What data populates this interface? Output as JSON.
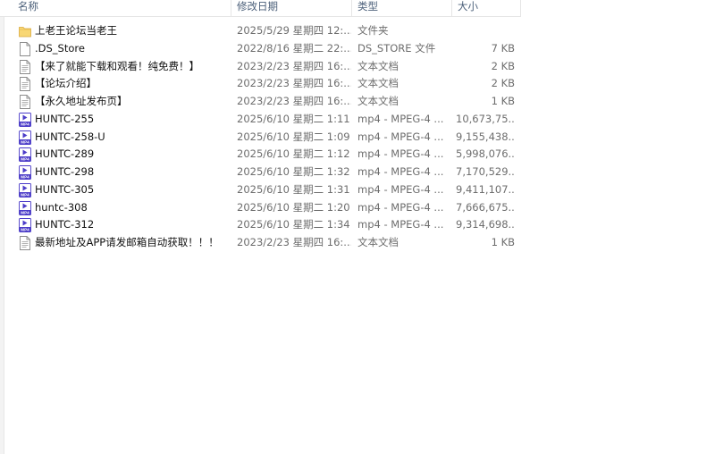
{
  "columns": {
    "name": "名称",
    "date": "修改日期",
    "type": "类型",
    "size": "大小"
  },
  "files": [
    {
      "icon": "folder-icon",
      "name": "上老王论坛当老王",
      "date": "2025/5/29 星期四 12:...",
      "type": "文件夹",
      "size": ""
    },
    {
      "icon": "file-icon",
      "name": ".DS_Store",
      "date": "2022/8/16 星期二 22:...",
      "type": "DS_STORE 文件",
      "size": "7 KB"
    },
    {
      "icon": "text-file-icon",
      "name": "【来了就能下载和观看！纯免费！】",
      "date": "2023/2/23 星期四 16:...",
      "type": "文本文档",
      "size": "2 KB"
    },
    {
      "icon": "text-file-icon",
      "name": "【论坛介绍】",
      "date": "2023/2/23 星期四 16:...",
      "type": "文本文档",
      "size": "2 KB"
    },
    {
      "icon": "text-file-icon",
      "name": "【永久地址发布页】",
      "date": "2023/2/23 星期四 16:...",
      "type": "文本文档",
      "size": "1 KB"
    },
    {
      "icon": "mp4-icon",
      "name": "HUNTC-255",
      "date": "2025/6/10 星期二 1:11",
      "type": "mp4 - MPEG-4 ...",
      "size": "10,673,75..."
    },
    {
      "icon": "mp4-icon",
      "name": "HUNTC-258-U",
      "date": "2025/6/10 星期二 1:09",
      "type": "mp4 - MPEG-4 ...",
      "size": "9,155,438..."
    },
    {
      "icon": "mp4-icon",
      "name": "HUNTC-289",
      "date": "2025/6/10 星期二 1:12",
      "type": "mp4 - MPEG-4 ...",
      "size": "5,998,076..."
    },
    {
      "icon": "mp4-icon",
      "name": "HUNTC-298",
      "date": "2025/6/10 星期二 1:32",
      "type": "mp4 - MPEG-4 ...",
      "size": "7,170,529..."
    },
    {
      "icon": "mp4-icon",
      "name": "HUNTC-305",
      "date": "2025/6/10 星期二 1:31",
      "type": "mp4 - MPEG-4 ...",
      "size": "9,411,107..."
    },
    {
      "icon": "mp4-icon",
      "name": "huntc-308",
      "date": "2025/6/10 星期二 1:20",
      "type": "mp4 - MPEG-4 ...",
      "size": "7,666,675..."
    },
    {
      "icon": "mp4-icon",
      "name": "HUNTC-312",
      "date": "2025/6/10 星期二 1:34",
      "type": "mp4 - MPEG-4 ...",
      "size": "9,314,698..."
    },
    {
      "icon": "text-file-icon",
      "name": "最新地址及APP请发邮箱自动获取！！！",
      "date": "2023/2/23 星期四 16:...",
      "type": "文本文档",
      "size": "1 KB"
    }
  ],
  "colors": {
    "header_text": "#4c607a",
    "folder": "#f8d775",
    "mp4_icon": "#4b3cc8"
  }
}
